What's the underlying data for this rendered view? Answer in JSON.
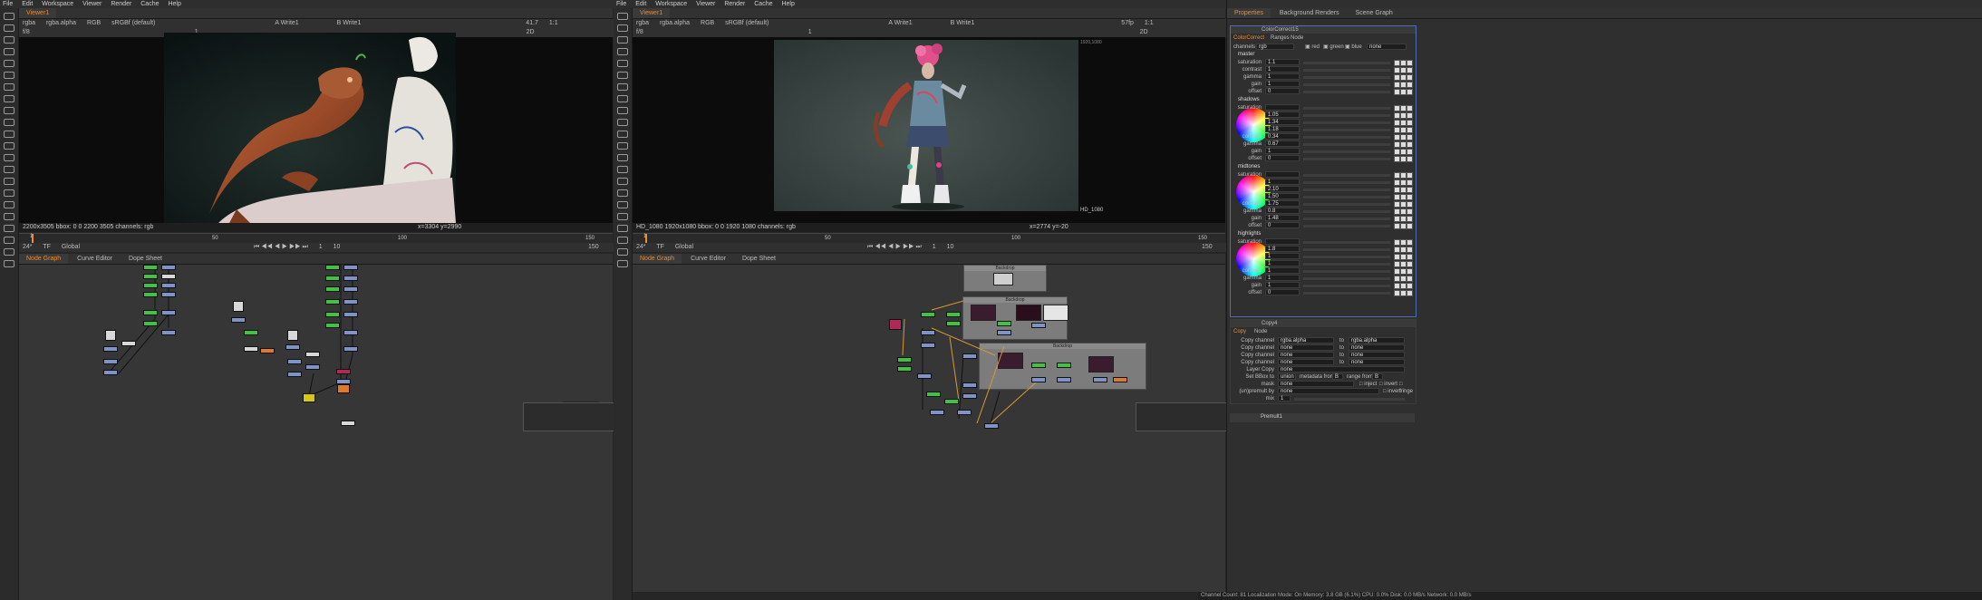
{
  "left_window": {
    "menu": [
      "File",
      "Edit",
      "Workspace",
      "Viewer",
      "Render",
      "Cache",
      "Help"
    ],
    "viewer_tab": "Viewer1",
    "channels": "rgba",
    "layer": "rgba.alpha",
    "colorspace": "RGB",
    "display": "sRGBf (default)",
    "input_a": "A  Write1",
    "input_b": "B  Write1",
    "zoom": "41.7",
    "proxy": "1:1",
    "mode": "2D",
    "fstop": "f/8",
    "frame_field": "1",
    "format_info": "2200x3505  bbox: 0 0 2200 3505 channels: rgb",
    "coords": "x=3304 y=2990",
    "timeline_marks": [
      "1",
      "50",
      "100",
      "150"
    ],
    "fps": "24*",
    "tf": "TF",
    "range": "Global",
    "current_frame": "1",
    "frame_step": "10",
    "end_frame": "150",
    "graph_tabs": [
      "Node Graph",
      "Curve Editor",
      "Dope Sheet"
    ]
  },
  "right_window": {
    "menu": [
      "File",
      "Edit",
      "Workspace",
      "Viewer",
      "Render",
      "Cache",
      "Help"
    ],
    "viewer_tab": "Viewer1",
    "channels": "rgba",
    "layer": "rgba.alpha",
    "colorspace": "RGB",
    "display": "sRGBf (default)",
    "input_a": "A  Write1",
    "input_b": "B  Write1",
    "fps_readout": "57fp",
    "proxy": "1:1",
    "mode": "2D",
    "fstop": "f/8",
    "frame_field": "1",
    "format_info": "HD_1080 1920x1080  bbox: 0 0 1920 1080 channels: rgb",
    "coords": "x=2774 y=-20",
    "format_label": "HD_1080",
    "format_label_top": "1920,1080",
    "timeline_marks": [
      "1",
      "50",
      "100",
      "150"
    ],
    "fps": "24*",
    "tf": "TF",
    "range": "Global",
    "current_frame": "1",
    "frame_step": "10",
    "end_frame": "150",
    "graph_tabs": [
      "Node Graph",
      "Curve Editor",
      "Dope Sheet"
    ],
    "backdrop_labels": [
      "Backdrop",
      "Backdrop",
      "Backdrop"
    ],
    "status": "Channel Count: 81  Localization Mode: On  Memory: 3.8 GB (6.1%)  CPU: 0.0%  Disk: 0.0 MB/s  Network: 0.0 MB/s"
  },
  "properties": {
    "tabs": [
      "Properties",
      "Background Renders",
      "Scene Graph"
    ],
    "node_name": "ColorCorrect15",
    "node_tabs": [
      "ColorCorrect",
      "Ranges",
      "Node"
    ],
    "channels_label": "channels",
    "channels_value": "rgb",
    "channel_checks": [
      "red",
      "green",
      "blue"
    ],
    "channel_extra": "none",
    "sections": [
      {
        "name": "master",
        "rows": [
          {
            "label": "saturation",
            "value": "1.1"
          },
          {
            "label": "contrast",
            "value": "1"
          },
          {
            "label": "gamma",
            "value": "1"
          },
          {
            "label": "gain",
            "value": "1"
          },
          {
            "label": "offset",
            "value": "0"
          }
        ]
      },
      {
        "name": "shadows",
        "rows": [
          {
            "label": "saturation",
            "value": ""
          },
          {
            "label": "",
            "value": "1.05"
          },
          {
            "label": "",
            "value": "1.34"
          },
          {
            "label": "",
            "value": "1.18"
          },
          {
            "label": "contrast",
            "value": "0.34"
          },
          {
            "label": "gamma",
            "value": "0.67"
          },
          {
            "label": "gain",
            "value": "1"
          },
          {
            "label": "offset",
            "value": "0"
          }
        ]
      },
      {
        "name": "midtones",
        "rows": [
          {
            "label": "saturation",
            "value": ""
          },
          {
            "label": "",
            "value": "1"
          },
          {
            "label": "",
            "value": "2.10"
          },
          {
            "label": "",
            "value": "1.50"
          },
          {
            "label": "contrast",
            "value": "1.75"
          },
          {
            "label": "gamma",
            "value": "0.8"
          },
          {
            "label": "gain",
            "value": "1.48"
          },
          {
            "label": "offset",
            "value": "0"
          }
        ]
      },
      {
        "name": "highlights",
        "rows": [
          {
            "label": "saturation",
            "value": ""
          },
          {
            "label": "",
            "value": "1.8"
          },
          {
            "label": "",
            "value": "1"
          },
          {
            "label": "",
            "value": "1"
          },
          {
            "label": "contrast",
            "value": "1"
          },
          {
            "label": "gamma",
            "value": "1"
          },
          {
            "label": "gain",
            "value": "1"
          },
          {
            "label": "offset",
            "value": "0"
          }
        ]
      }
    ],
    "copy_node_name": "Copy4",
    "copy_tabs": [
      "Copy",
      "Node"
    ],
    "copy_rows": [
      {
        "label": "Copy channel",
        "from": "rgba.alpha",
        "to_label": "to",
        "to": "rgba.alpha"
      },
      {
        "label": "Copy channel",
        "from": "none",
        "to_label": "to",
        "to": "none"
      },
      {
        "label": "Copy channel",
        "from": "none",
        "to_label": "to",
        "to": "none"
      },
      {
        "label": "Copy channel",
        "from": "none",
        "to_label": "to",
        "to": "none"
      }
    ],
    "layer_copy_label": "Layer Copy",
    "layer_copy_value": "none",
    "set_bbox_label": "Set BBox to",
    "set_bbox_value": "union",
    "metadata_label": "metadata from",
    "metadata_value": "B",
    "range_label": "range from",
    "range_value": "B",
    "mask_label": "mask",
    "mask_value": "none",
    "inject_label": "inject",
    "invert_label": "invert",
    "fringe_label": "fringe",
    "unpremult_label": "(un)premult by",
    "unpremult_value": "none",
    "invert2_label": "invert",
    "mix_label": "mix",
    "mix_value": "1",
    "premult_node_name": "Premult1",
    "accent_color": "#f08a2a"
  }
}
